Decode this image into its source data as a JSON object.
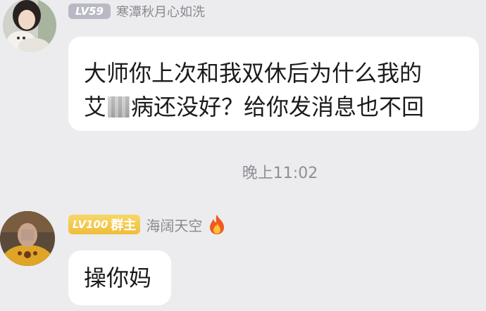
{
  "messages": [
    {
      "level": "LV59",
      "nickname": "寒潭秋月心如洗",
      "text_line1": "大师你上次和我双休后为什么我的",
      "text_line2_prefix": "艾",
      "text_line2_suffix": "病还没好？给你发消息也不回",
      "level_badge_color": "#b9b9c6"
    },
    {
      "level": "LV100",
      "role_badge": "群主",
      "nickname": "海阔天空",
      "text": "操你妈",
      "level_badge_color": "#efbd3a"
    }
  ],
  "timestamp": "晚上11:02",
  "icons": {
    "censor_block": "pixelated-censor",
    "nickname_decoration": "fire-icon"
  }
}
